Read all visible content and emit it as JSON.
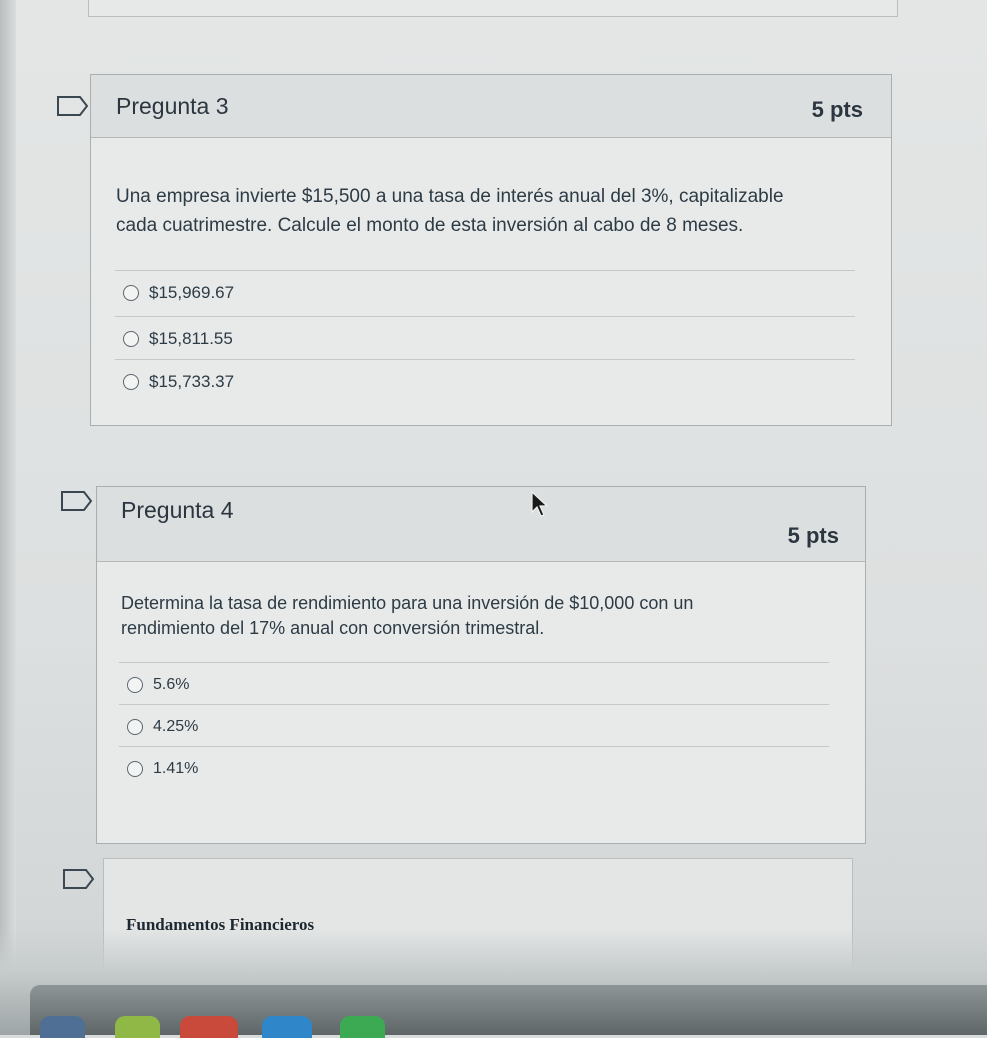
{
  "questions": [
    {
      "title": "Pregunta 3",
      "points": "5 pts",
      "text_line1": "Una empresa invierte $15,500 a una tasa de interés anual del 3%, capitalizable",
      "text_line2": "cada cuatrimestre. Calcule el monto de esta inversión al cabo de 8 meses.",
      "answers": [
        "$15,969.67",
        "$15,811.55",
        "$15,733.37"
      ]
    },
    {
      "title": "Pregunta 4",
      "points": "5 pts",
      "text_line1": "Determina la tasa de rendimiento para una inversión de $10,000 con un",
      "text_line2": "rendimiento del 17% anual con conversión trimestral.",
      "answers": [
        "5.6%",
        "4.25%",
        "1.41%"
      ]
    }
  ],
  "footer": {
    "course_name": "Fundamentos Financieros"
  },
  "icons": {
    "flag": "flag-icon",
    "radio": "radio-button-icon",
    "cursor": "mouse-pointer-icon"
  },
  "colors": {
    "text": "#2d3b45",
    "header_bg": "#dcdfdf",
    "border": "#a9aeae"
  }
}
